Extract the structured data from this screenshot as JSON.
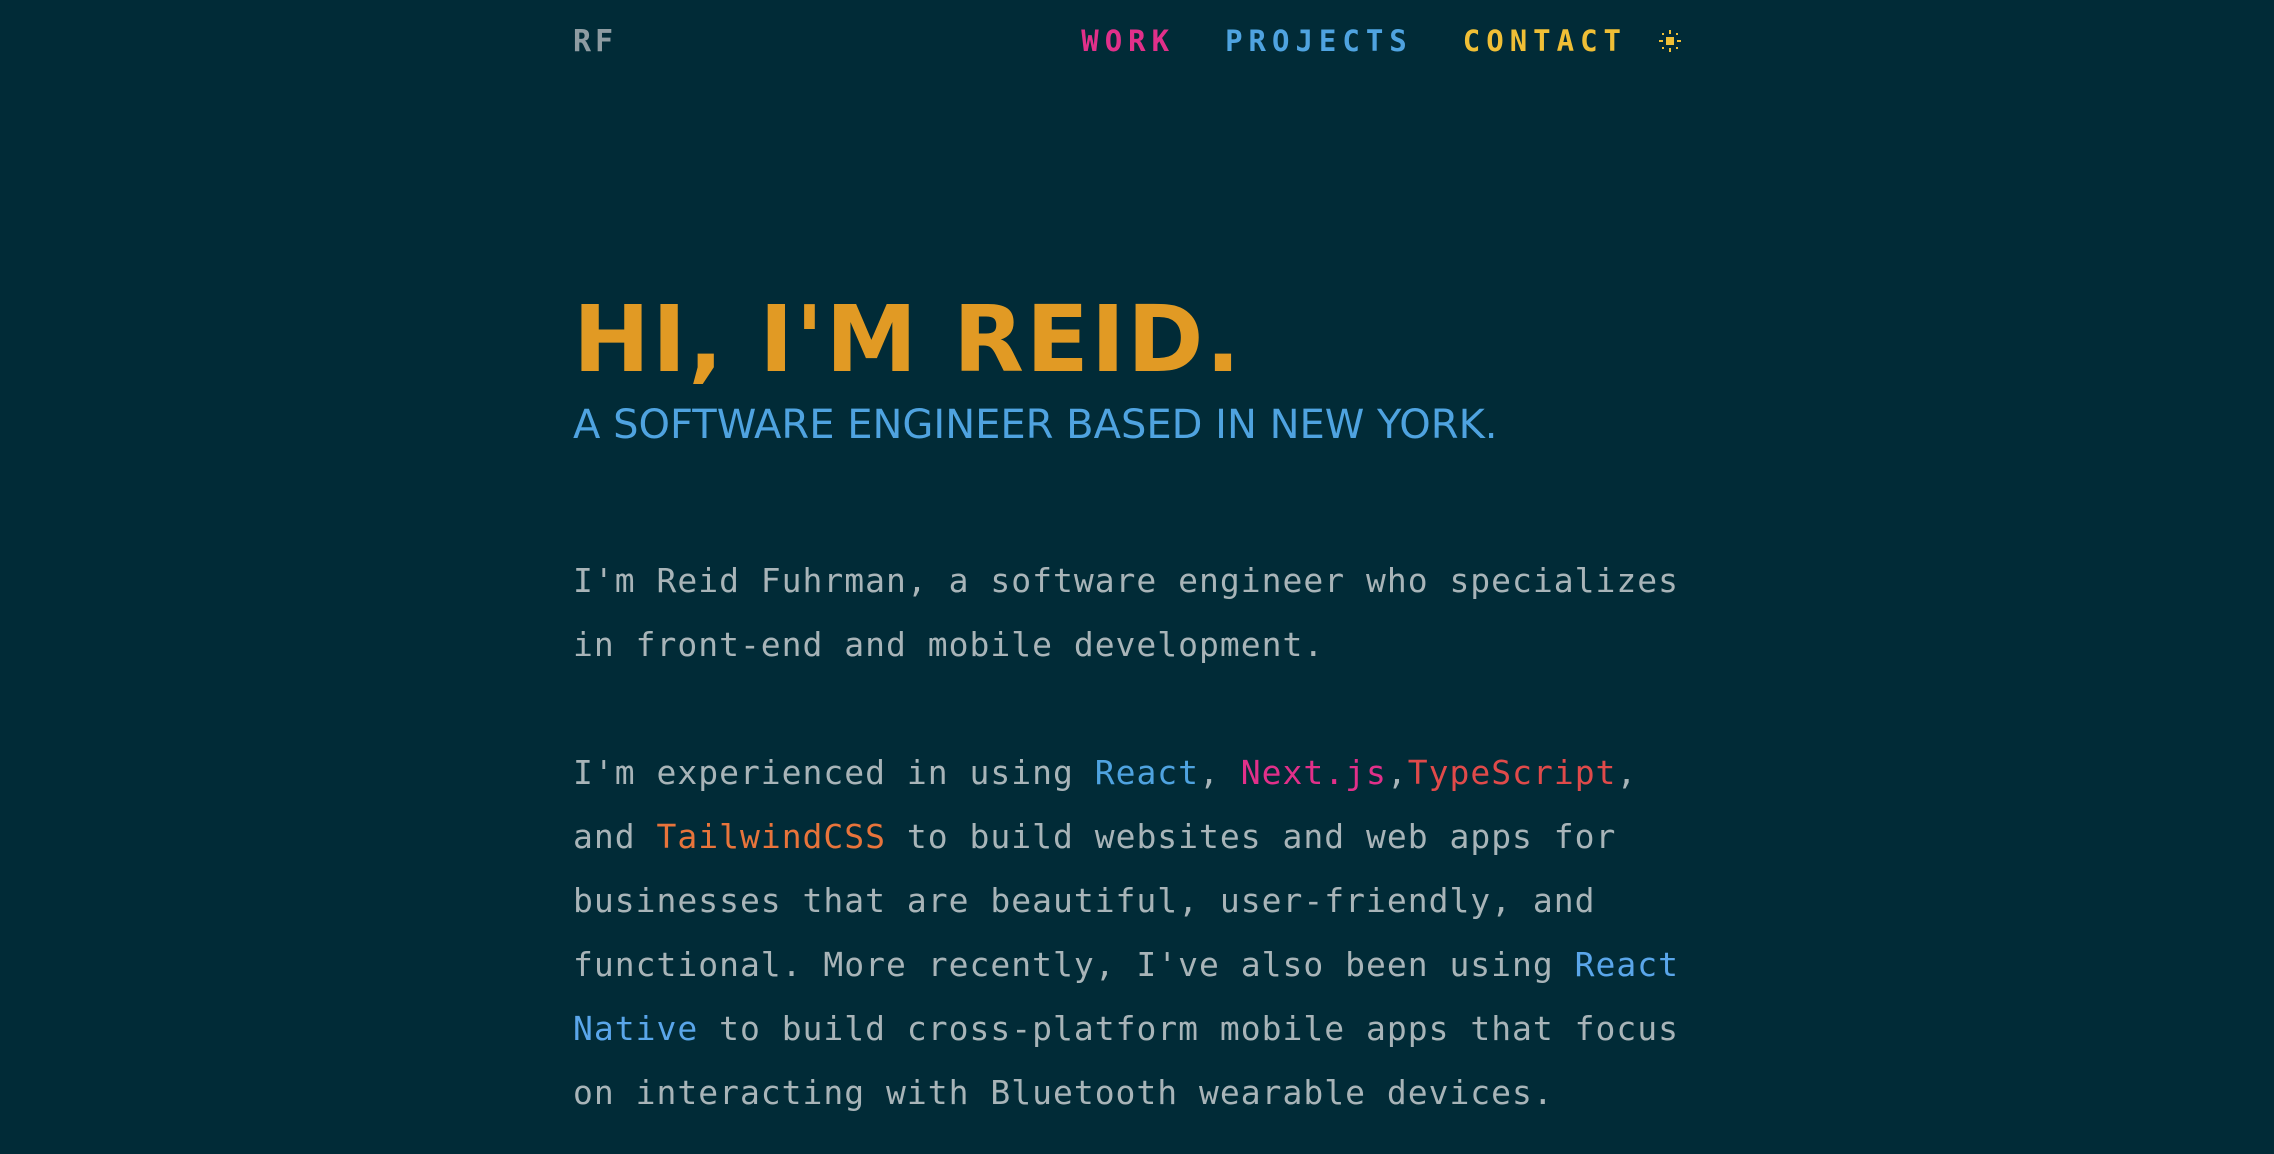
{
  "nav": {
    "logo": "RF",
    "links": [
      {
        "label": "WORK",
        "color": "#e1308a"
      },
      {
        "label": "PROJECTS",
        "color": "#4fa3e0"
      },
      {
        "label": "CONTACT",
        "color": "#f0bf36"
      }
    ],
    "theme_toggle_icon": "sun-icon"
  },
  "hero": {
    "title": "HI, I'M REID.",
    "subtitle": "A SOFTWARE ENGINEER BASED IN NEW YORK."
  },
  "about": {
    "paragraph1": "I'm Reid Fuhrman, a software engineer who specializes in front-end and mobile development.",
    "p2_intro": "I'm experienced in using ",
    "tech_react": "React",
    "sep1": ", ",
    "tech_next": "Next.js",
    "sep2": ",",
    "tech_typescript": "TypeScript",
    "sep3": ", and ",
    "tech_tailwind": "TailwindCSS",
    "p2_middle": " to build websites and web apps for businesses that are beautiful, user-friendly, and functional. More recently, I've also been using ",
    "tech_react_native": "React Native",
    "p2_end": " to build cross-platform mobile apps that focus on interacting with Bluetooth wearable devices."
  },
  "colors": {
    "background": "#012b37",
    "title": "#e19a24",
    "subtitle": "#4fa3e0",
    "body_text": "#a8b4b8"
  }
}
